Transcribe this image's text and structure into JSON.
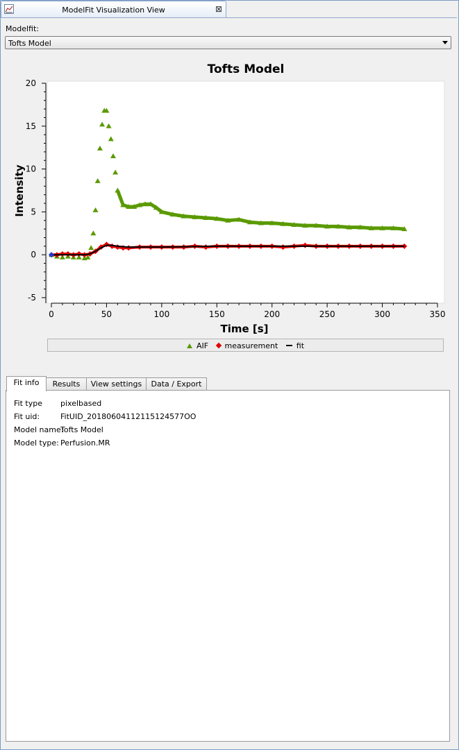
{
  "view_tab": {
    "title": "ModelFit Visualization View",
    "close_icon": "close-icon"
  },
  "modelfit": {
    "label": "Modelfit:",
    "selected": "Tofts Model"
  },
  "chart_data": {
    "type": "scatter",
    "title": "Tofts Model",
    "xlabel": "Time [s]",
    "ylabel": "Intensity",
    "xlim": [
      0,
      350
    ],
    "ylim": [
      -5,
      20
    ],
    "xticks": [
      0,
      50,
      100,
      150,
      200,
      250,
      300,
      350
    ],
    "yticks": [
      -5,
      0,
      5,
      10,
      15,
      20
    ],
    "legend_position": "bottom",
    "series": [
      {
        "name": "AIF",
        "marker": "triangle",
        "color": "#5a9a00",
        "x": [
          0,
          5,
          10,
          15,
          20,
          25,
          30,
          33,
          36,
          38,
          40,
          42,
          44,
          46,
          48,
          50,
          52,
          54,
          56,
          58,
          60,
          65,
          70,
          75,
          80,
          85,
          90,
          95,
          100,
          110,
          120,
          130,
          140,
          150,
          160,
          170,
          180,
          190,
          200,
          210,
          220,
          230,
          240,
          250,
          260,
          270,
          280,
          290,
          300,
          310,
          320
        ],
        "y": [
          0,
          -0.2,
          -0.3,
          -0.2,
          -0.3,
          -0.3,
          -0.4,
          -0.3,
          0.8,
          2.5,
          5.2,
          8.6,
          12.4,
          15.2,
          16.8,
          16.8,
          15.0,
          13.5,
          11.5,
          9.6,
          7.5,
          5.8,
          5.6,
          5.6,
          5.8,
          5.9,
          5.9,
          5.5,
          5.0,
          4.7,
          4.5,
          4.4,
          4.3,
          4.2,
          4.0,
          4.1,
          3.8,
          3.7,
          3.7,
          3.6,
          3.5,
          3.4,
          3.4,
          3.3,
          3.3,
          3.2,
          3.2,
          3.1,
          3.1,
          3.1,
          3.0
        ]
      },
      {
        "name": "measurement",
        "marker": "diamond",
        "color": "#e00000",
        "x": [
          0,
          5,
          10,
          15,
          20,
          25,
          30,
          35,
          40,
          45,
          50,
          55,
          60,
          65,
          70,
          80,
          90,
          100,
          110,
          120,
          130,
          140,
          150,
          160,
          170,
          180,
          190,
          200,
          210,
          220,
          230,
          240,
          250,
          260,
          270,
          280,
          290,
          300,
          310,
          320
        ],
        "y": [
          0,
          0,
          0.1,
          0.1,
          0,
          0.1,
          0,
          0.1,
          0.4,
          0.9,
          1.2,
          1.0,
          0.9,
          0.8,
          0.8,
          0.9,
          0.9,
          0.9,
          0.9,
          0.9,
          1.0,
          0.9,
          1.0,
          1.0,
          1.0,
          1.0,
          1.0,
          1.0,
          0.9,
          1.0,
          1.1,
          1.0,
          1.0,
          1.0,
          1.0,
          1.0,
          1.0,
          1.0,
          1.0,
          1.0
        ]
      },
      {
        "name": "fit",
        "marker": "line",
        "color": "#000000",
        "x": [
          0,
          10,
          20,
          30,
          35,
          40,
          45,
          50,
          55,
          60,
          70,
          80,
          100,
          150,
          200,
          250,
          300,
          320
        ],
        "y": [
          0,
          0,
          0,
          0,
          0.1,
          0.4,
          0.8,
          1.1,
          1.1,
          1.0,
          0.9,
          0.9,
          0.9,
          1.0,
          1.0,
          1.0,
          1.0,
          1.0
        ]
      },
      {
        "name": "",
        "marker": "diamond",
        "color": "#1a3cd8",
        "x": [
          0
        ],
        "y": [
          0
        ]
      }
    ]
  },
  "tabs": [
    {
      "label": "Fit info",
      "active": true
    },
    {
      "label": "Results",
      "active": false
    },
    {
      "label": "View settings",
      "active": false
    },
    {
      "label": "Data / Export",
      "active": false
    }
  ],
  "fit_info": [
    {
      "key": "Fit type",
      "value": "pixelbased"
    },
    {
      "key": "Fit uid:",
      "value": "FitUID_20180604112115124577OO"
    },
    {
      "key": "Model name:",
      "value": "Tofts Model"
    },
    {
      "key": "Model type:",
      "value": "Perfusion.MR"
    }
  ]
}
